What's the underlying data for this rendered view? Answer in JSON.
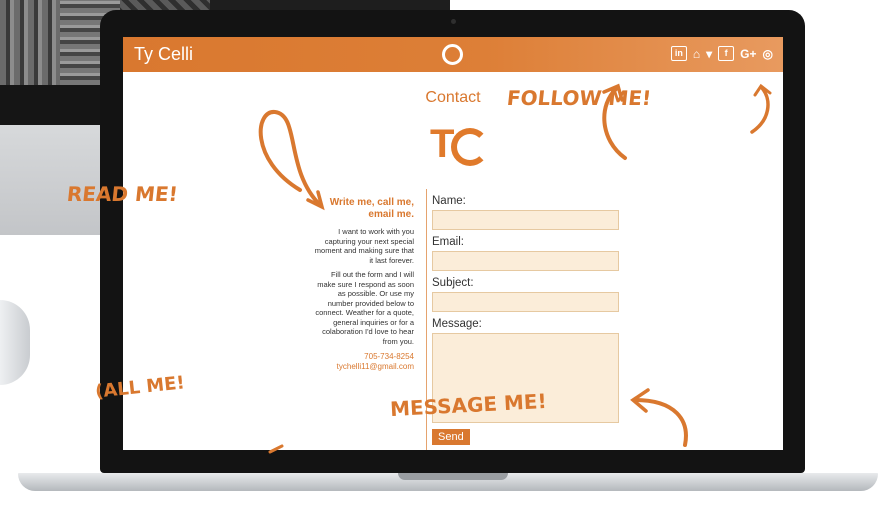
{
  "site": {
    "title": "Ty Celli",
    "social_icons": [
      "linkedin-icon",
      "snapchat-icon",
      "twitter-icon",
      "facebook-icon",
      "google-plus-icon",
      "instagram-icon"
    ],
    "social_glyphs": {
      "linkedin": "in",
      "snapchat": "⌂",
      "twitter": "▾",
      "facebook": "f",
      "googleplus": "G+",
      "instagram": "◎"
    }
  },
  "page": {
    "heading": "Contact",
    "logo_letters": "T"
  },
  "left": {
    "lead": "Write me, call me, email me.",
    "para1": "I want to work with you capturing your next special moment and making sure that it last forever.",
    "para2": "Fill out the form and I will make sure I respond as soon as possible. Or use my number provided below to connect. Weather for a quote, general inquiries or for a colaboration I'd love to hear from you.",
    "phone": "705-734-8254",
    "email": "tychelli11@gmail.com"
  },
  "form": {
    "name_label": "Name:",
    "email_label": "Email:",
    "subject_label": "Subject:",
    "message_label": "Message:",
    "send_label": "Send"
  },
  "annotations": {
    "read": "READ ME!",
    "follow": "FOLLOW ME!",
    "call": "(ALL ME!",
    "message": "MESSAGE ME!"
  },
  "colors": {
    "accent": "#d9782f",
    "field": "#fbedd9"
  }
}
